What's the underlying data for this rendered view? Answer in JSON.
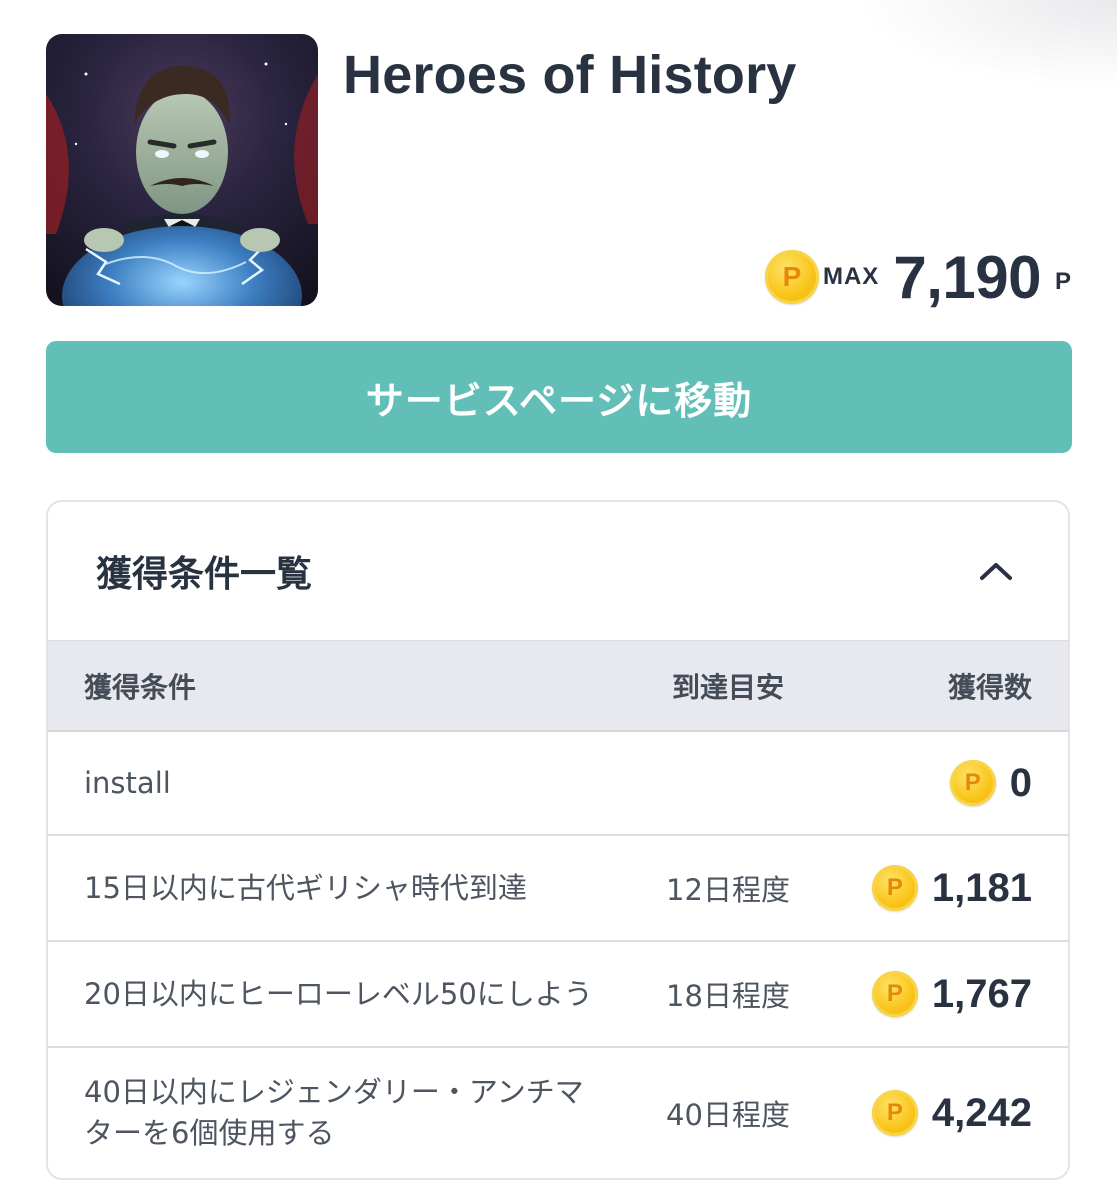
{
  "app": {
    "title": "Heroes of History",
    "icon": "heroes-of-history-app-icon"
  },
  "reward": {
    "coin_symbol": "P",
    "max_label": "MAX",
    "max_value": "7,190",
    "unit": "P"
  },
  "cta": {
    "label": "サービスページに移動",
    "color": "#62bfb7"
  },
  "panel": {
    "title": "獲得条件一覧",
    "toggle_icon": "chevron-up-icon",
    "columns": {
      "condition": "獲得条件",
      "estimate": "到達目安",
      "points": "獲得数"
    },
    "rows": [
      {
        "condition": "install",
        "estimate": "",
        "points": "0"
      },
      {
        "condition": "15日以内に古代ギリシャ時代到達",
        "estimate": "12日程度",
        "points": "1,181"
      },
      {
        "condition": "20日以内にヒーローレベル50にしよう",
        "estimate": "18日程度",
        "points": "1,767"
      },
      {
        "condition": "40日以内にレジェンダリー・アンチマターを6個使用する",
        "estimate": "40日程度",
        "points": "4,242"
      }
    ]
  },
  "colors": {
    "coin": "#f9c51a",
    "coin_letter": "#e48a06",
    "text_dark": "#283241",
    "table_header_bg": "#e8e9ee"
  }
}
